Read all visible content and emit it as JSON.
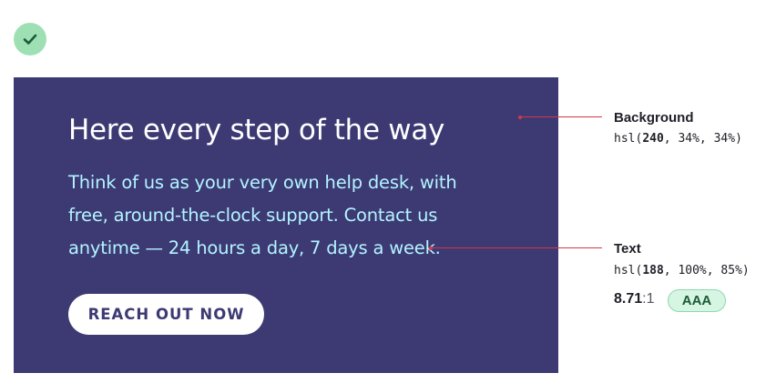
{
  "status": {
    "icon": "check-icon",
    "color": "#9ee0b4"
  },
  "card": {
    "background_color": "#3d3a73",
    "text_color": "#b3f4ff",
    "heading": "Here every step of the way",
    "body": "Think of us as your very own help desk, with free, around-the-clock support. Contact us anytime — 24 hours a day, 7 days a week.",
    "cta_label": "REACH OUT NOW"
  },
  "annotations": {
    "background": {
      "title": "Background",
      "value_prefix": "hsl(",
      "value_hue": "240",
      "value_rest": ", 34%, 34%)"
    },
    "text": {
      "title": "Text",
      "value_prefix": "hsl(",
      "value_hue": "188",
      "value_rest": ", 100%, 85%)"
    },
    "contrast": {
      "ratio_value": "8.71",
      "ratio_suffix": ":1",
      "grade": "AAA"
    },
    "leader_color": "#d0384a"
  }
}
